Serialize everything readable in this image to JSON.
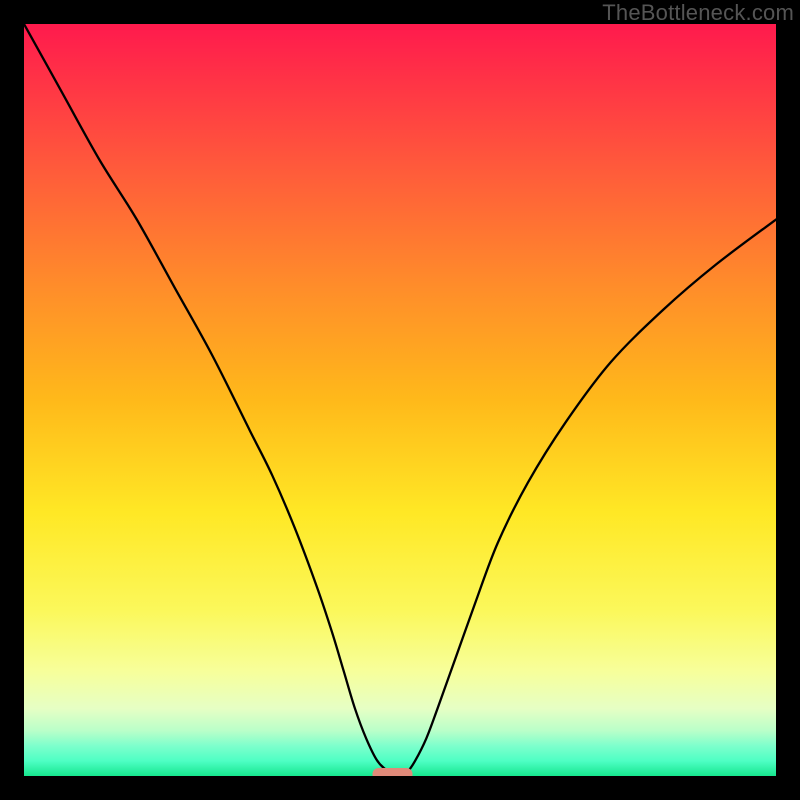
{
  "watermark": "TheBottleneck.com",
  "chart_data": {
    "type": "line",
    "title": "",
    "xlabel": "",
    "ylabel": "",
    "xlim": [
      0,
      100
    ],
    "ylim": [
      0,
      100
    ],
    "grid": false,
    "series": [
      {
        "name": "curve",
        "x": [
          0,
          5,
          10,
          15,
          20,
          25,
          30,
          33,
          36,
          39,
          41,
          42.5,
          44,
          45.5,
          47,
          48.5,
          50,
          51,
          52,
          53.5,
          55,
          57.5,
          60,
          63,
          67,
          72,
          78,
          85,
          92,
          100
        ],
        "values": [
          100,
          91,
          82,
          74,
          65,
          56,
          46,
          40,
          33,
          25,
          19,
          14,
          9,
          5,
          2,
          0.6,
          0.2,
          0.6,
          2,
          5,
          9,
          16,
          23,
          31,
          39,
          47,
          55,
          62,
          68,
          74
        ]
      }
    ],
    "marker": {
      "x": 49,
      "y": 0.2,
      "color": "#e08a7a"
    },
    "background_gradient": {
      "top": "#ff1a4d",
      "mid": "#ffe825",
      "bottom": "#16e68e"
    }
  }
}
